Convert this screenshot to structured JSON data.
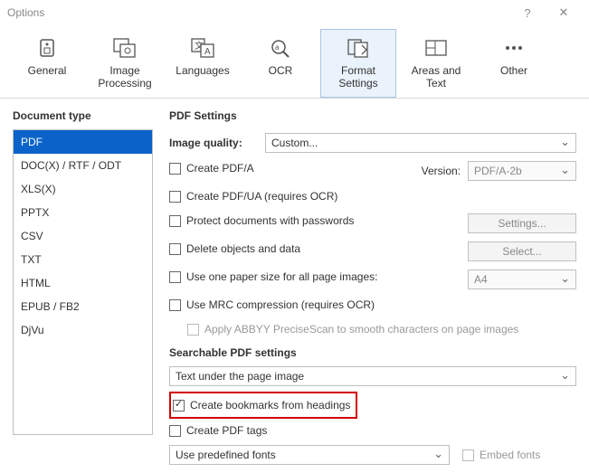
{
  "window": {
    "title": "Options"
  },
  "toolbar": [
    {
      "label": "General"
    },
    {
      "label": "Image\nProcessing"
    },
    {
      "label": "Languages"
    },
    {
      "label": "OCR"
    },
    {
      "label": "Format\nSettings"
    },
    {
      "label": "Areas and Text"
    },
    {
      "label": "Other"
    }
  ],
  "left": {
    "heading": "Document type",
    "items": [
      "PDF",
      "DOC(X) / RTF / ODT",
      "XLS(X)",
      "PPTX",
      "CSV",
      "TXT",
      "HTML",
      "EPUB / FB2",
      "DjVu"
    ]
  },
  "right": {
    "heading": "PDF Settings",
    "imagequality_label": "Image quality:",
    "imagequality_value": "Custom...",
    "create_pdfa": "Create PDF/A",
    "version_label": "Version:",
    "version_value": "PDF/A-2b",
    "create_pdfua": "Create PDF/UA (requires OCR)",
    "protect": "Protect documents with passwords",
    "settings_btn": "Settings...",
    "delete_obj": "Delete objects and data",
    "select_btn": "Select...",
    "one_paper": "Use one paper size for all page images:",
    "paper_value": "A4",
    "mrc": "Use MRC compression (requires OCR)",
    "precisescan": "Apply ABBYY PreciseScan to smooth characters on page images",
    "searchable_head": "Searchable PDF settings",
    "searchable_value": "Text under the page image",
    "bookmarks": "Create bookmarks from headings",
    "tags": "Create PDF tags",
    "fonts_value": "Use predefined fonts",
    "embed_fonts": "Embed fonts"
  }
}
